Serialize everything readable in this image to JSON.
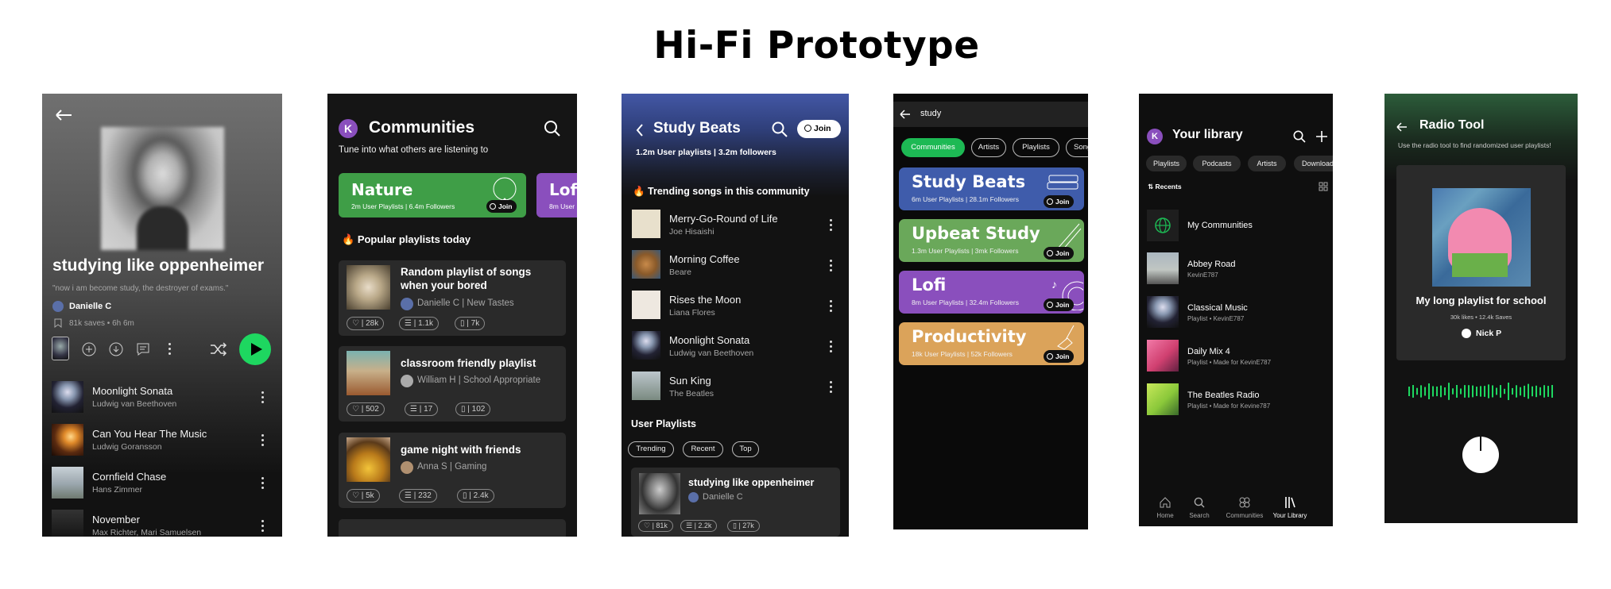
{
  "page_title": "Hi-Fi Prototype",
  "playlist_screen": {
    "title": "studying like oppenheimer",
    "description": "\"now i am become study, the destroyer of exams.\"",
    "owner": "Danielle C",
    "meta": "81k saves • 6h 6m",
    "tracks": [
      {
        "title": "Moonlight Sonata",
        "artist": "Ludwig van Beethoven"
      },
      {
        "title": "Can You Hear The Music",
        "artist": "Ludwig Goransson"
      },
      {
        "title": "Cornfield Chase",
        "artist": "Hans Zimmer"
      },
      {
        "title": "November",
        "artist": "Max Richter, Mari Samuelsen"
      }
    ]
  },
  "communities_screen": {
    "avatar_letter": "K",
    "title": "Communities",
    "subtitle": "Tune into what others are listening to",
    "featured": [
      {
        "name": "Nature",
        "stats": "2m User Playlists | 6.4m Followers",
        "join": "Join"
      },
      {
        "name": "Lofi",
        "stats": "8m User"
      }
    ],
    "section_title": "Popular playlists today",
    "playlists": [
      {
        "title": "Random playlist of songs when your bored",
        "byline": "Danielle C | New Tastes",
        "likes": "28k",
        "comments": "1.1k",
        "saves": "7k"
      },
      {
        "title": "classroom friendly playlist",
        "byline": "William H | School Appropriate",
        "likes": "502",
        "comments": "17",
        "saves": "102"
      },
      {
        "title": "game night with friends",
        "byline": "Anna S | Gaming",
        "likes": "5k",
        "comments": "232",
        "saves": "2.4k"
      }
    ]
  },
  "community_screen": {
    "title": "Study Beats",
    "join": "Join",
    "stats": "1.2m User playlists | 3.2m followers",
    "trending_title": "Trending songs in this community",
    "songs": [
      {
        "title": "Merry-Go-Round of Life",
        "artist": "Joe Hisaishi"
      },
      {
        "title": "Morning Coffee",
        "artist": "Beare"
      },
      {
        "title": "Rises the Moon",
        "artist": "Liana Flores"
      },
      {
        "title": "Moonlight Sonata",
        "artist": "Ludwig van Beethoven"
      },
      {
        "title": "Sun King",
        "artist": "The Beatles"
      }
    ],
    "user_playlists_title": "User Playlists",
    "filters": [
      "Trending",
      "Recent",
      "Top"
    ],
    "playlist": {
      "title": "studying like oppenheimer",
      "owner": "Danielle C",
      "likes": "81k",
      "comments": "2.2k",
      "saves": "27k"
    }
  },
  "search_screen": {
    "query": "study",
    "chips": [
      "Communities",
      "Artists",
      "Playlists",
      "Songs"
    ],
    "results": [
      {
        "name": "Study Beats",
        "stats": "6m User Playlists | 28.1m Followers",
        "color": "#3f5cab",
        "join": "Join"
      },
      {
        "name": "Upbeat Study",
        "stats": "1.3m User Playlists | 3mk Followers",
        "color": "#6aa85a",
        "join": "Join"
      },
      {
        "name": "Lofi",
        "stats": "8m User Playlists | 32.4m Followers",
        "color": "#8a4fbd",
        "join": "Join"
      },
      {
        "name": "Productivity",
        "stats": "18k User Playlists | 52k Followers",
        "color": "#dba35a",
        "join": "Join"
      }
    ]
  },
  "library_screen": {
    "avatar_letter": "K",
    "title": "Your library",
    "chips": [
      "Playlists",
      "Podcasts",
      "Artists",
      "Downloads"
    ],
    "sort_label": "Recents",
    "items": [
      {
        "title": "My Communities",
        "subtitle": ""
      },
      {
        "title": "Abbey Road",
        "subtitle": "KevinE787"
      },
      {
        "title": "Classical Music",
        "subtitle": "Playlist • KevinE787"
      },
      {
        "title": "Daily Mix 4",
        "subtitle": "Playlist • Made for KevinE787"
      },
      {
        "title": "The Beatles Radio",
        "subtitle": "Playlist • Made for Kevine787"
      }
    ],
    "nav": [
      "Home",
      "Search",
      "Communities",
      "Your Library"
    ]
  },
  "radio_screen": {
    "title": "Radio Tool",
    "subtitle": "Use the radio tool to find randomized user playlists!",
    "playlist_title": "My long playlist for school",
    "playlist_meta": "30k likes • 12.4k Saves",
    "owner": "Nick P"
  },
  "colors": {
    "spotify_green": "#1ed760",
    "purple": "#8a4fbd",
    "nature_green": "#3f9e47"
  }
}
